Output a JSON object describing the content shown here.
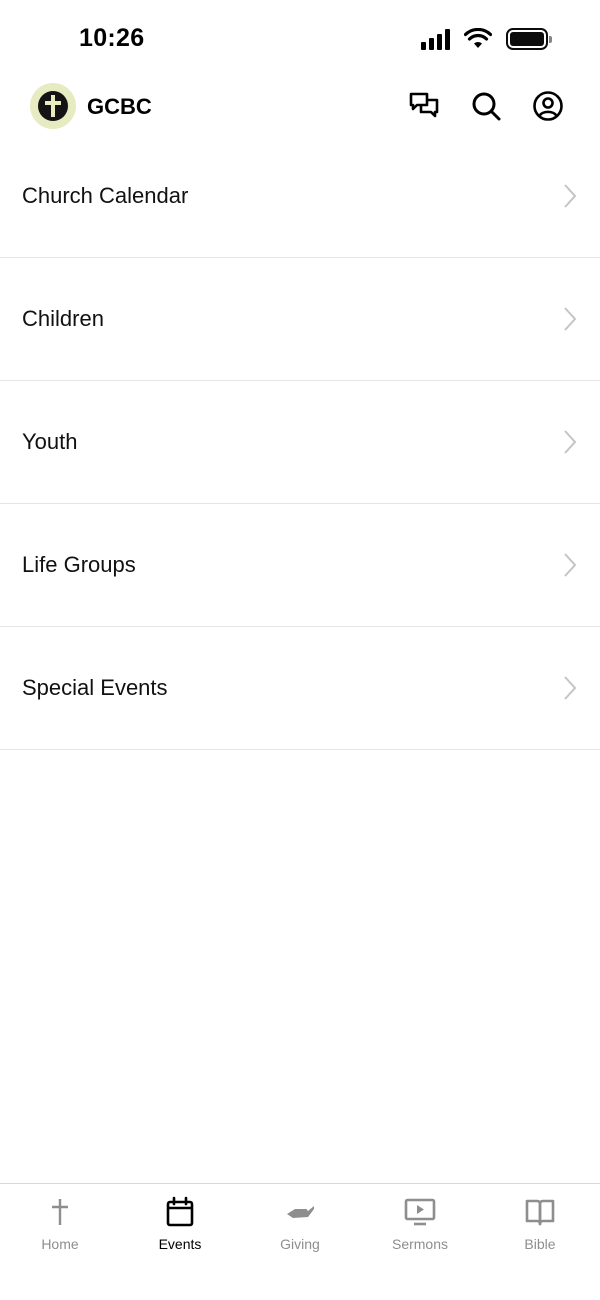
{
  "status_bar": {
    "time": "10:26"
  },
  "header": {
    "app_name": "GCBC"
  },
  "menu": {
    "items": [
      {
        "label": "Church Calendar"
      },
      {
        "label": "Children"
      },
      {
        "label": "Youth"
      },
      {
        "label": "Life Groups"
      },
      {
        "label": "Special Events"
      }
    ]
  },
  "tabs": {
    "items": [
      {
        "label": "Home",
        "icon": "cross-icon"
      },
      {
        "label": "Events",
        "icon": "calendar-icon",
        "active": true
      },
      {
        "label": "Giving",
        "icon": "giving-hand-icon"
      },
      {
        "label": "Sermons",
        "icon": "video-play-icon"
      },
      {
        "label": "Bible",
        "icon": "open-book-icon"
      }
    ],
    "active_color": "#000000",
    "inactive_color": "#8e8e8e"
  }
}
